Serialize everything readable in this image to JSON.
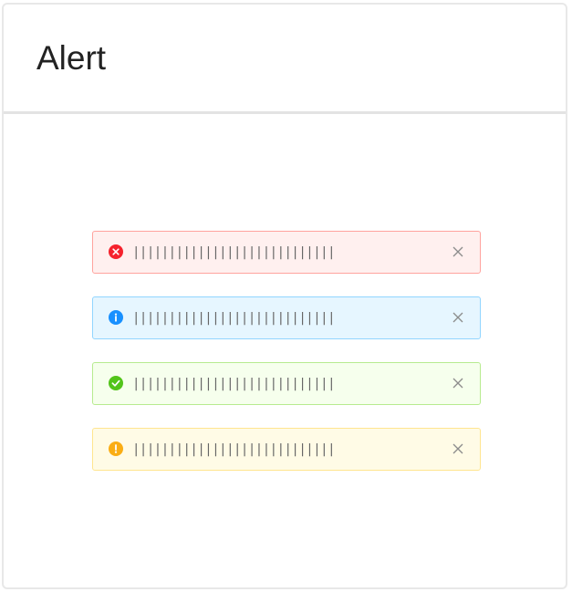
{
  "card": {
    "title": "Alert"
  },
  "alerts": [
    {
      "type": "error",
      "icon": "close-circle-icon",
      "color": "#f5222d",
      "message": "||||||||||||||||||||||||||||||||||||||||||||||||||||||||||||||||||||||||||||||||||||||||||||"
    },
    {
      "type": "info",
      "icon": "info-circle-icon",
      "color": "#1890ff",
      "message": "||||||||||||||||||||||||||||||||||||||||||||||||||||||||||||||||||||||||||||||||||||||||||||"
    },
    {
      "type": "success",
      "icon": "check-circle-icon",
      "color": "#52c41a",
      "message": "||||||||||||||||||||||||||||||||||||||||||||||||||||||||||||||||||||||||||||||||||||||||||||"
    },
    {
      "type": "warning",
      "icon": "exclamation-circle-icon",
      "color": "#faad14",
      "message": "||||||||||||||||||||||||||||||||||||||||||||||||||||||||||||||||||||||||||||||||||||||||||||"
    }
  ]
}
